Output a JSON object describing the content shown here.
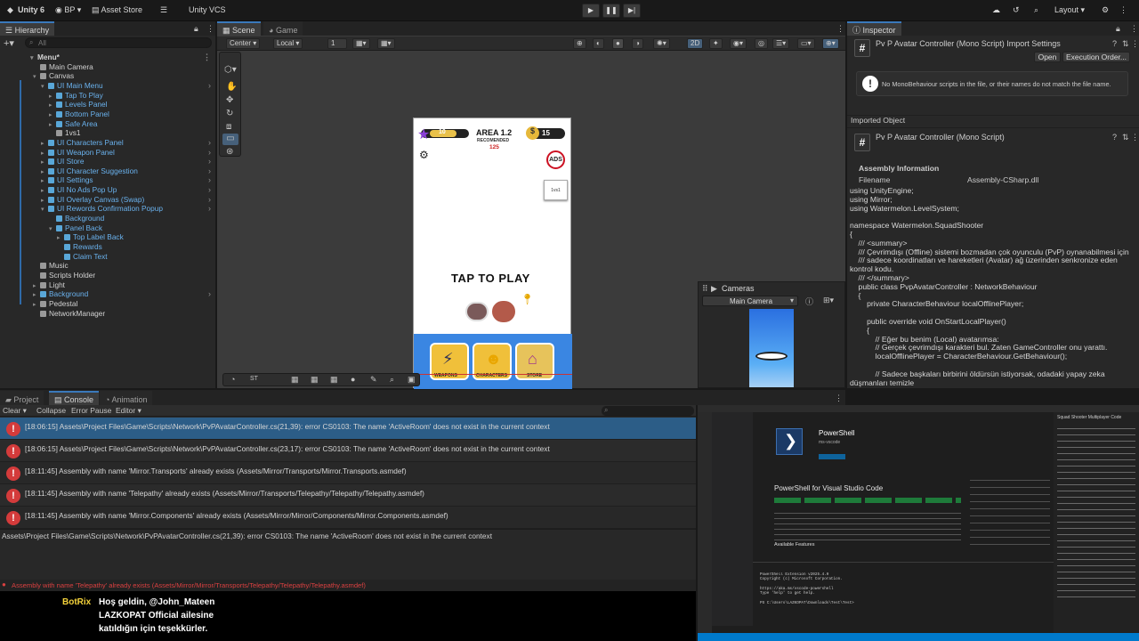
{
  "topbar": {
    "app": "Unity 6",
    "account": "BP",
    "asset_store": "Asset Store",
    "vcs": "Unity VCS",
    "layout": "Layout"
  },
  "hierarchy": {
    "tab": "Hierarchy",
    "search_placeholder": "All",
    "rows": [
      {
        "label": "Menu*",
        "depth": 0,
        "kind": "scene",
        "fold": "open"
      },
      {
        "label": "Main Camera",
        "depth": 1,
        "kind": "go",
        "fold": ""
      },
      {
        "label": "Canvas",
        "depth": 1,
        "kind": "go",
        "fold": "open"
      },
      {
        "label": "UI Main Menu",
        "depth": 2,
        "kind": "prefab",
        "fold": "open",
        "chev": true
      },
      {
        "label": "Tap To Play",
        "depth": 3,
        "kind": "prefab",
        "fold": "closed"
      },
      {
        "label": "Levels Panel",
        "depth": 3,
        "kind": "prefab",
        "fold": "closed"
      },
      {
        "label": "Bottom Panel",
        "depth": 3,
        "kind": "prefab",
        "fold": "closed"
      },
      {
        "label": "Safe Area",
        "depth": 3,
        "kind": "prefab",
        "fold": "closed"
      },
      {
        "label": "1vs1",
        "depth": 3,
        "kind": "go",
        "fold": ""
      },
      {
        "label": "UI Characters Panel",
        "depth": 2,
        "kind": "prefab",
        "fold": "closed",
        "chev": true
      },
      {
        "label": "UI Weapon Panel",
        "depth": 2,
        "kind": "prefab",
        "fold": "closed",
        "chev": true
      },
      {
        "label": "UI Store",
        "depth": 2,
        "kind": "prefab",
        "fold": "closed",
        "chev": true
      },
      {
        "label": "UI Character Suggestion",
        "depth": 2,
        "kind": "prefab",
        "fold": "closed",
        "chev": true
      },
      {
        "label": "UI Settings",
        "depth": 2,
        "kind": "prefab",
        "fold": "closed",
        "chev": true
      },
      {
        "label": "UI No Ads Pop Up",
        "depth": 2,
        "kind": "prefab",
        "fold": "closed",
        "chev": true
      },
      {
        "label": "UI Overlay Canvas (Swap)",
        "depth": 2,
        "kind": "prefab",
        "fold": "closed",
        "chev": true
      },
      {
        "label": "UI Rewords Confirmation Popup",
        "depth": 2,
        "kind": "prefab",
        "fold": "open",
        "chev": true
      },
      {
        "label": "Background",
        "depth": 3,
        "kind": "prefab",
        "fold": ""
      },
      {
        "label": "Panel Back",
        "depth": 3,
        "kind": "prefab",
        "fold": "open"
      },
      {
        "label": "Top Label Back",
        "depth": 4,
        "kind": "prefab",
        "fold": "closed"
      },
      {
        "label": "Rewards",
        "depth": 4,
        "kind": "prefab",
        "fold": ""
      },
      {
        "label": "Claim Text",
        "depth": 4,
        "kind": "prefab",
        "fold": ""
      },
      {
        "label": "Music",
        "depth": 1,
        "kind": "go",
        "fold": ""
      },
      {
        "label": "Scripts Holder",
        "depth": 1,
        "kind": "go",
        "fold": ""
      },
      {
        "label": "Light",
        "depth": 1,
        "kind": "go",
        "fold": "closed"
      },
      {
        "label": "Background",
        "depth": 1,
        "kind": "prefab",
        "fold": "closed",
        "chev": true
      },
      {
        "label": "Pedestal",
        "depth": 1,
        "kind": "go",
        "fold": "closed"
      },
      {
        "label": "NetworkManager",
        "depth": 1,
        "kind": "go",
        "fold": ""
      }
    ]
  },
  "scene": {
    "tabs": [
      "Scene",
      "Game"
    ],
    "pivot": "Center",
    "space": "Local",
    "snap": "1",
    "mode2d": "2D",
    "game": {
      "area": "AREA 1.2",
      "recommended": "RECOMENDED",
      "rec_value": "125",
      "level": "10",
      "coins": "15",
      "ads": "ADS",
      "side_button": "1vs1",
      "tap": "TAP TO PLAY",
      "bottom": [
        "WEAPONS",
        "CHARACTERS",
        "STORE"
      ]
    },
    "cameras": {
      "title": "Cameras",
      "selected": "Main Camera"
    }
  },
  "inspector": {
    "tab": "Inspector",
    "title": "Pv P Avatar Controller (Mono Script) Import Settings",
    "open": "Open",
    "exec": "Execution Order...",
    "warning": "No MonoBehaviour scripts in the file, or their names do not match the file name.",
    "imported": "Imported Object",
    "script_title": "Pv P Avatar Controller (Mono Script)",
    "assembly_header": "Assembly Information",
    "filename_label": "Filename",
    "filename_value": "Assembly-CSharp.dll",
    "code": "using UnityEngine;\nusing Mirror;\nusing Watermelon.LevelSystem;\n\nnamespace Watermelon.SquadShooter\n{\n    /// <summary>\n    /// Çevrimdışı (Offline) sistemi bozmadan çok oyunculu (PvP) oynanabilmesi için\n    /// sadece koordinatları ve hareketleri (Avatar) ağ üzerinden senkronize eden\nkontrol kodu.\n    /// </summary>\n    public class PvpAvatarController : NetworkBehaviour\n    {\n        private CharacterBehaviour localOfflinePlayer;\n\n        public override void OnStartLocalPlayer()\n        {\n            // Eğer bu benim (Local) avatarımsa:\n            // Gerçek çevrimdışı karakteri bul. Zaten GameController onu yarattı.\n            localOfflinePlayer = CharacterBehaviour.GetBehaviour();\n\n            // Sadece başkaları birbirini öldürsün istiyorsak, odadaki yapay zeka\ndüşmanları temizle\n            if (PvPState.IsPvPMode && ActiveRoom.CurrentLevelData != null)\n            {"
  },
  "console": {
    "tabs": [
      "Project",
      "Console",
      "Animation"
    ],
    "clear": "Clear",
    "collapse": "Collapse",
    "error_pause": "Error Pause",
    "editor": "Editor",
    "entries": [
      "[18:06:15] Assets\\Project Files\\Game\\Scripts\\Network\\PvPAvatarController.cs(21,39): error CS0103: The name 'ActiveRoom' does not exist in the current context",
      "[18:06:15] Assets\\Project Files\\Game\\Scripts\\Network\\PvPAvatarController.cs(23,17): error CS0103: The name 'ActiveRoom' does not exist in the current context",
      "[18:11:45] Assembly with name 'Mirror.Transports' already exists (Assets/Mirror/Transports/Mirror.Transports.asmdef)",
      "[18:11:45] Assembly with name 'Telepathy' already exists (Assets/Mirror/Transports/Telepathy/Telepathy/Telepathy.asmdef)",
      "[18:11:45] Assembly with name 'Mirror.Components' already exists (Assets/Mirror/Mirror/Components/Mirror.Components.asmdef)"
    ],
    "detail": "Assets\\Project Files\\Game\\Scripts\\Network\\PvPAvatarController.cs(21,39): error CS0103: The name 'ActiveRoom' does not exist in the current context",
    "status": "Assembly with name 'Telepathy' already exists (Assets/Mirror/Mirror/Transports/Telepathy/Telepathy/Telepathy.asmdef)"
  },
  "chat": {
    "user": "BotRix",
    "line1": "Hoş geldin, @John_Mateen",
    "line2": "LAZKOPAT Official ailesine",
    "line3": "katıldığın için teşekkürler."
  },
  "vscode": {
    "ext_title": "PowerShell",
    "ext_publisher": "ms-vscode",
    "heading": "PowerShell for Visual Studio Code",
    "section": "Available Features",
    "terminal": "PowerShell Extension v2025.4.0\nCopyright (c) Microsoft Corporation.\n\nhttps://aka.ms/vscode-powershell\nType 'help' to get help.\n\nPS C:\\Users\\LAZKOPAT\\Downloads\\Test\\Test>",
    "side_title": "Squad Shooter Multiplayer Code"
  }
}
